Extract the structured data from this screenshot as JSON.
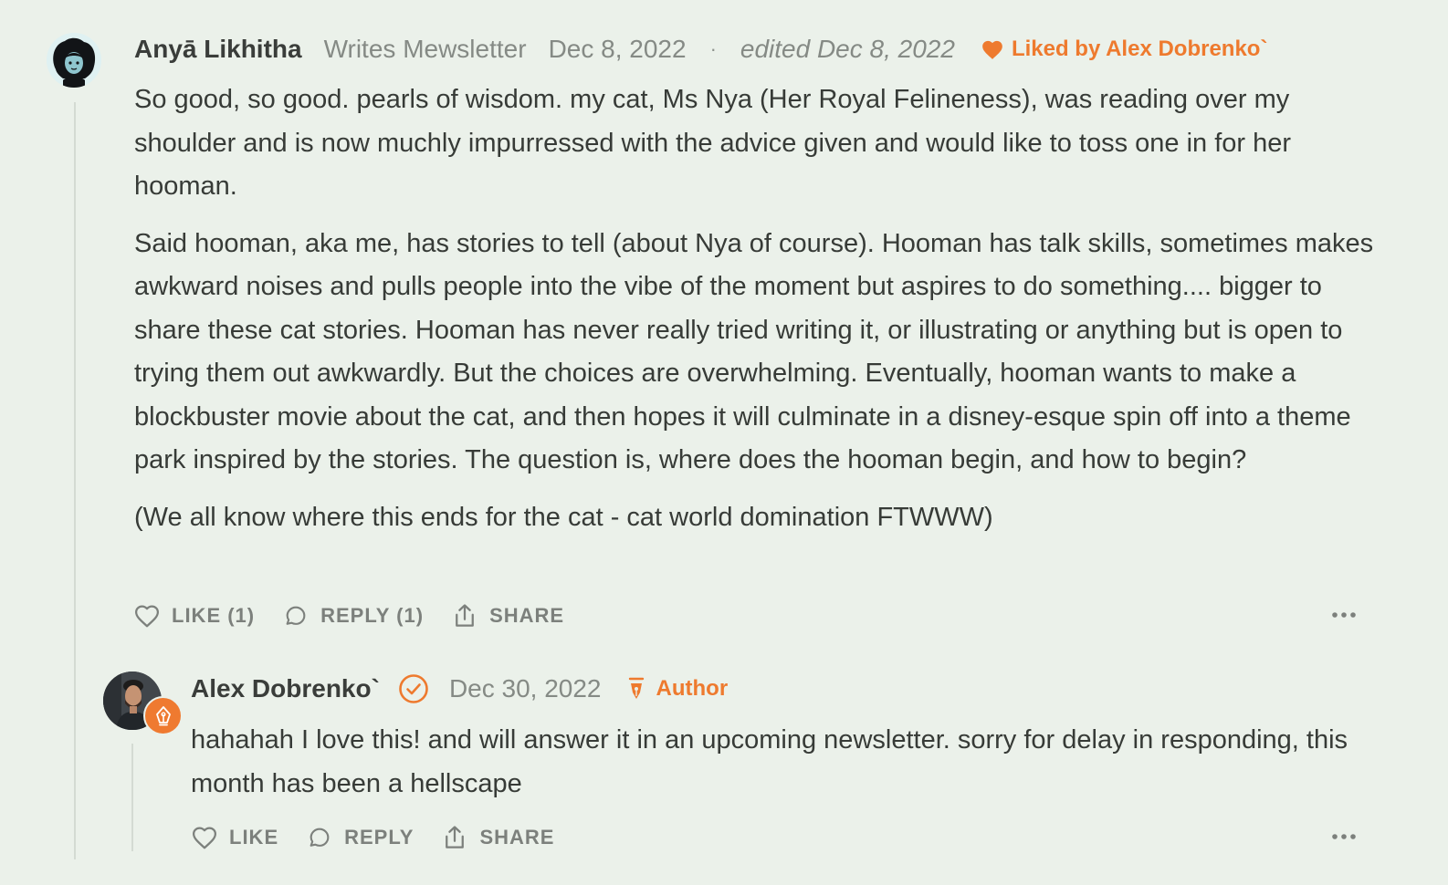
{
  "comment": {
    "author": "Anyā Likhitha",
    "publication": "Writes Mewsletter",
    "date": "Dec 8, 2022",
    "separator": "·",
    "edited": "edited Dec 8, 2022",
    "liked_by": "Liked by Alex Dobrenko`",
    "paragraphs": [
      "So good, so good. pearls of wisdom. my cat, Ms Nya (Her Royal Felineness), was reading over my shoulder and is now muchly impurressed with the advice given and would like to toss one in for her hooman.",
      "Said hooman, aka me, has stories to tell (about Nya of course). Hooman has talk skills, sometimes makes awkward noises and pulls people into the vibe of the moment but aspires to do something.... bigger to share these cat stories. Hooman has never really tried writing it, or illustrating or anything but is open to trying them out awkwardly. But the choices are overwhelming. Eventually, hooman wants to make a blockbuster movie about the cat, and then hopes it will culminate in a disney-esque spin off into a theme park inspired by the stories. The question is, where does the hooman begin, and how to begin?",
      "(We all know where this ends for the cat - cat world domination FTWWW)"
    ],
    "actions": {
      "like": "LIKE (1)",
      "reply": "REPLY (1)",
      "share": "SHARE"
    }
  },
  "reply": {
    "author": "Alex Dobrenko`",
    "date": "Dec 30, 2022",
    "role": "Author",
    "text": "hahahah I love this! and will answer it in an upcoming newsletter. sorry for delay in responding, this month has been a hellscape",
    "actions": {
      "like": "LIKE",
      "reply": "REPLY",
      "share": "SHARE"
    }
  },
  "colors": {
    "background": "#ebf1ea",
    "accent": "#ee7a2e",
    "muted": "#858a85",
    "text": "#373b37"
  },
  "icons": [
    "heart-icon",
    "comment-bubble-icon",
    "share-icon",
    "more-dots-icon",
    "verified-check-icon",
    "pen-nib-icon"
  ]
}
